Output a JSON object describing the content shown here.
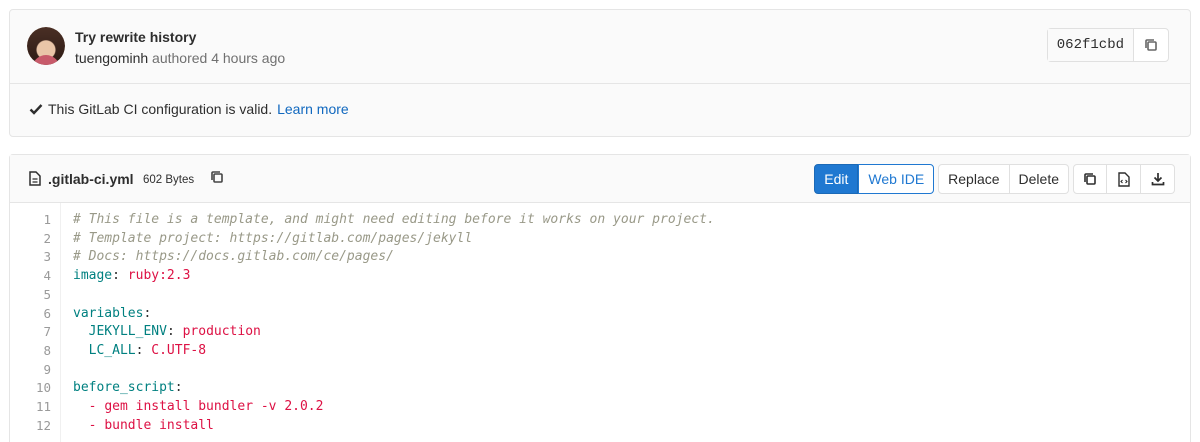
{
  "commit": {
    "title": "Try rewrite history",
    "author": "tuengominh",
    "meta_suffix": " authored 4 hours ago",
    "sha": "062f1cbd"
  },
  "ci": {
    "message": "This GitLab CI configuration is valid.",
    "link": "Learn more"
  },
  "file": {
    "name": ".gitlab-ci.yml",
    "size": "602 Bytes",
    "buttons": {
      "edit": "Edit",
      "web_ide": "Web IDE",
      "replace": "Replace",
      "delete": "Delete"
    }
  },
  "code": {
    "line_numbers": [
      "1",
      "2",
      "3",
      "4",
      "5",
      "6",
      "7",
      "8",
      "9",
      "10",
      "11",
      "12"
    ],
    "lines": [
      {
        "comment": "# This file is a template, and might need editing before it works on your project."
      },
      {
        "comment": "# Template project: https://gitlab.com/pages/jekyll"
      },
      {
        "comment": "# Docs: https://docs.gitlab.com/ce/pages/"
      },
      {
        "indent": "",
        "key": "image",
        "sep": ": ",
        "value": "ruby:2.3"
      },
      {},
      {
        "indent": "",
        "key": "variables",
        "sep": ":",
        "value": ""
      },
      {
        "indent": "  ",
        "key": "JEKYLL_ENV",
        "sep": ": ",
        "value": "production"
      },
      {
        "indent": "  ",
        "key": "LC_ALL",
        "sep": ": ",
        "value": "C.UTF-8"
      },
      {},
      {
        "indent": "",
        "key": "before_script",
        "sep": ":",
        "value": ""
      },
      {
        "indent": "  ",
        "dash": "- ",
        "value": "gem install bundler -v 2.0.2"
      },
      {
        "indent": "  ",
        "dash": "- ",
        "value": "bundle install"
      }
    ]
  },
  "colors": {
    "primary": "#1f78d1",
    "link": "#1068bf",
    "yaml_key": "#008080",
    "yaml_value": "#d14",
    "comment": "#998"
  }
}
